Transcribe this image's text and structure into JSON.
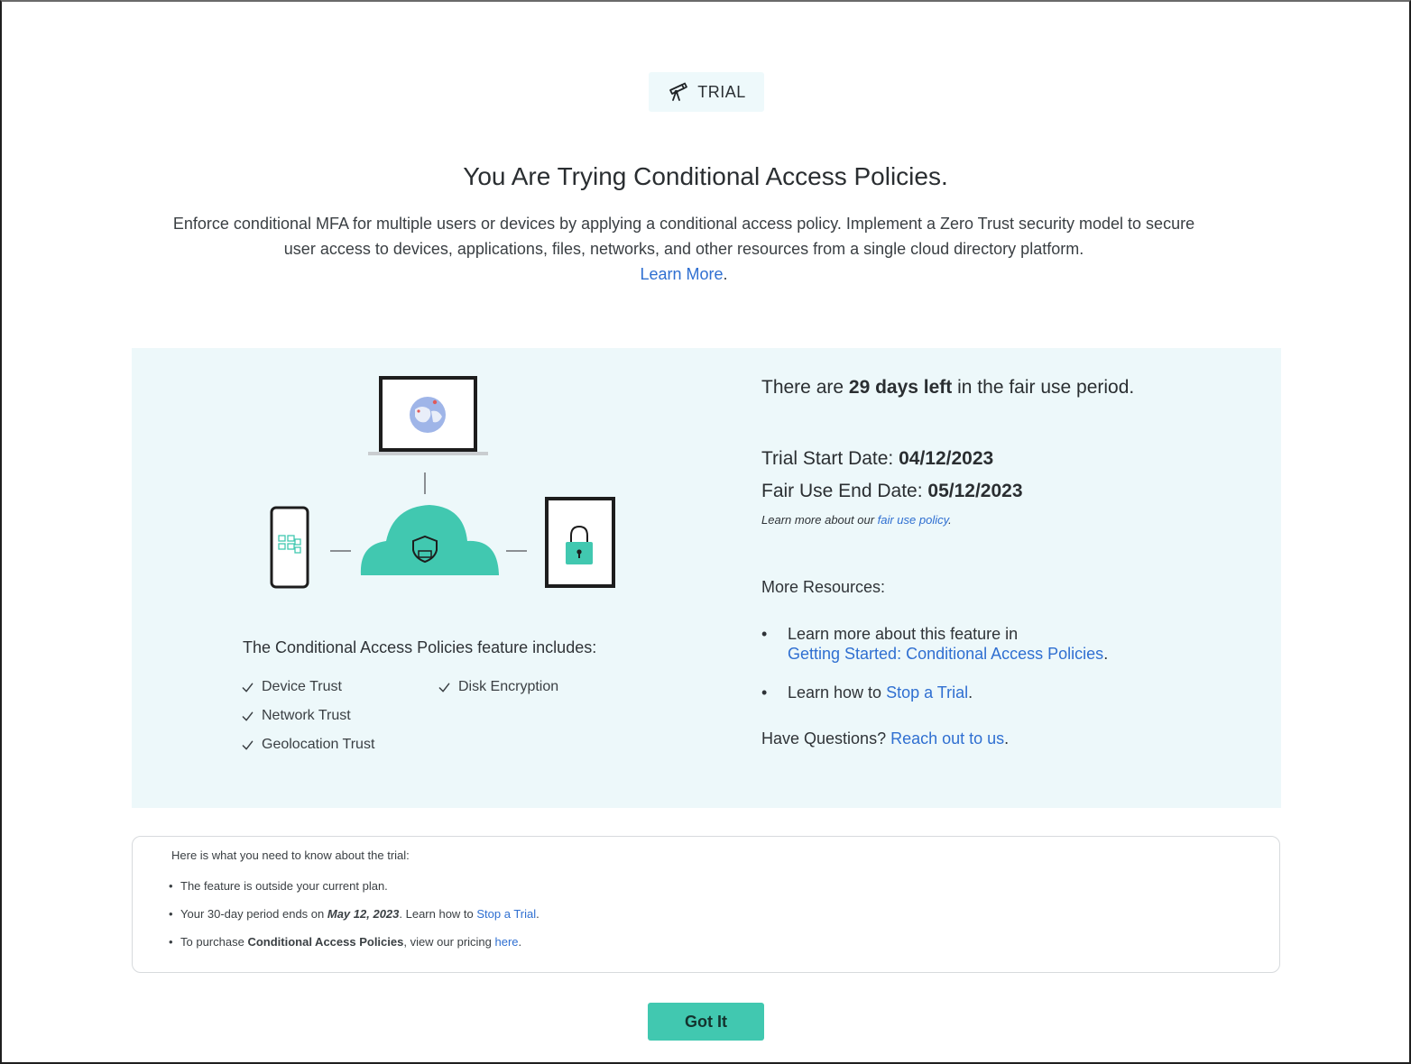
{
  "badge": {
    "label": "TRIAL",
    "icon": "telescope-icon"
  },
  "header": {
    "title": "You Are Trying Conditional Access Policies.",
    "intro": "Enforce conditional MFA for multiple users or devices by applying a conditional access policy. Implement a Zero Trust security model to secure user access to devices, applications, files, networks, and other resources from a single cloud directory platform.",
    "learn_more": "Learn More",
    "learn_more_suffix": "."
  },
  "features": {
    "title": "The Conditional Access Policies feature includes:",
    "left": [
      "Device Trust",
      "Network Trust",
      "Geolocation Trust"
    ],
    "right": [
      "Disk Encryption"
    ]
  },
  "status": {
    "days_prefix": "There are ",
    "days_bold": "29 days left",
    "days_suffix": " in the fair use period.",
    "start_label": "Trial Start Date: ",
    "start_value": "04/12/2023",
    "end_label": "Fair Use End Date: ",
    "end_value": "05/12/2023",
    "fair_note_prefix": "Learn more about our ",
    "fair_note_link": "fair use policy",
    "fair_note_suffix": "."
  },
  "resources": {
    "title": "More Resources:",
    "item1_text": "Learn more about this feature in",
    "item1_link": "Getting Started: Conditional Access Policies",
    "item2_text": "Learn how to ",
    "item2_link": "Stop a Trial",
    "period": ".",
    "questions_text": "Have Questions? ",
    "questions_link": "Reach out to us"
  },
  "info": {
    "heading": "Here is what you need to know about the trial:",
    "line1": "The feature is outside your current plan.",
    "line2_prefix": "Your 30-day period ends on ",
    "line2_bold": "May 12, 2023",
    "line2_mid": ". Learn how to ",
    "line2_link": "Stop a Trial",
    "line3_prefix": "To purchase ",
    "line3_bold": "Conditional Access Policies",
    "line3_mid": ", view our pricing ",
    "line3_link": "here",
    "period": "."
  },
  "footer": {
    "button_label": "Got It"
  },
  "colors": {
    "accent": "#41c8b0",
    "panel": "#edf8fa",
    "link": "#2f6fd1"
  }
}
